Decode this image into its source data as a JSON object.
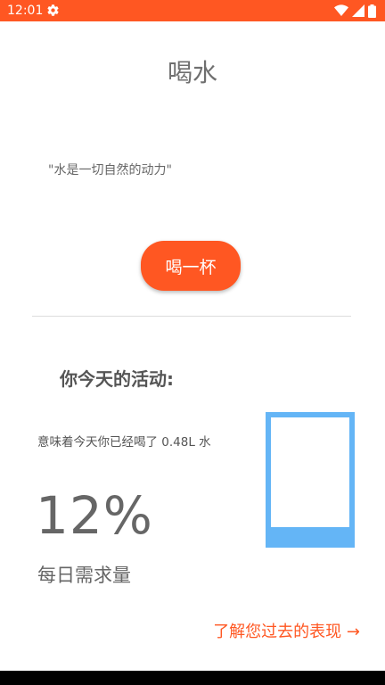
{
  "status_bar": {
    "time": "12:01",
    "icons": [
      "settings-icon",
      "wifi-icon",
      "signal-icon",
      "battery-icon"
    ],
    "background": "#ff5722"
  },
  "header": {
    "title": "喝水"
  },
  "quote": "\"水是一切自然的动力\"",
  "drink_button": {
    "label": "喝一杯",
    "color": "#ff5722"
  },
  "activity": {
    "heading": "你今天的活动:",
    "meaning_text": "意味着今天你已经喝了 0.48L 水",
    "percent": "12%",
    "progress_fraction": 0.12,
    "daily_label": "每日需求量",
    "glass_color": "#64b5f6"
  },
  "history_link": {
    "label": "了解您过去的表现 →"
  },
  "colors": {
    "accent": "#ff5722",
    "water": "#64b5f6"
  }
}
